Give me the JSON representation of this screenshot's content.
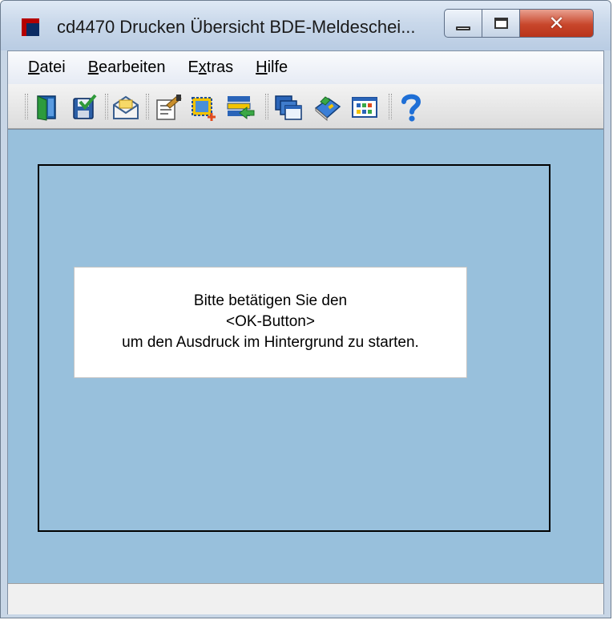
{
  "window": {
    "title": "cd4470 Drucken Übersicht BDE-Meldeschei...",
    "buttons": {
      "minimize": "minimize",
      "maximize": "maximize",
      "close": "✕"
    }
  },
  "menubar": {
    "items": [
      {
        "pre": "",
        "key": "D",
        "post": "atei"
      },
      {
        "pre": "",
        "key": "B",
        "post": "earbeiten"
      },
      {
        "pre": "E",
        "key": "x",
        "post": "tras"
      },
      {
        "pre": "",
        "key": "H",
        "post": "ilfe"
      }
    ]
  },
  "toolbar": {
    "icons": [
      "door-exit-icon",
      "save-check-icon",
      "envelope-icon",
      "edit-document-icon",
      "select-add-icon",
      "list-arrow-icon",
      "windows-stack-icon",
      "book-tag-icon",
      "color-grid-icon",
      "help-question-icon"
    ],
    "colors": {
      "accent_blue": "#1f6fd6",
      "green": "#2f9a3a",
      "yellow": "#f2c300"
    }
  },
  "message": {
    "line1": "Bitte betätigen Sie den",
    "line2": "<OK-Button>",
    "line3": "um den Ausdruck im Hintergrund zu starten."
  },
  "colors": {
    "client_background": "#98c0dc",
    "close_button": "#c8462b"
  }
}
